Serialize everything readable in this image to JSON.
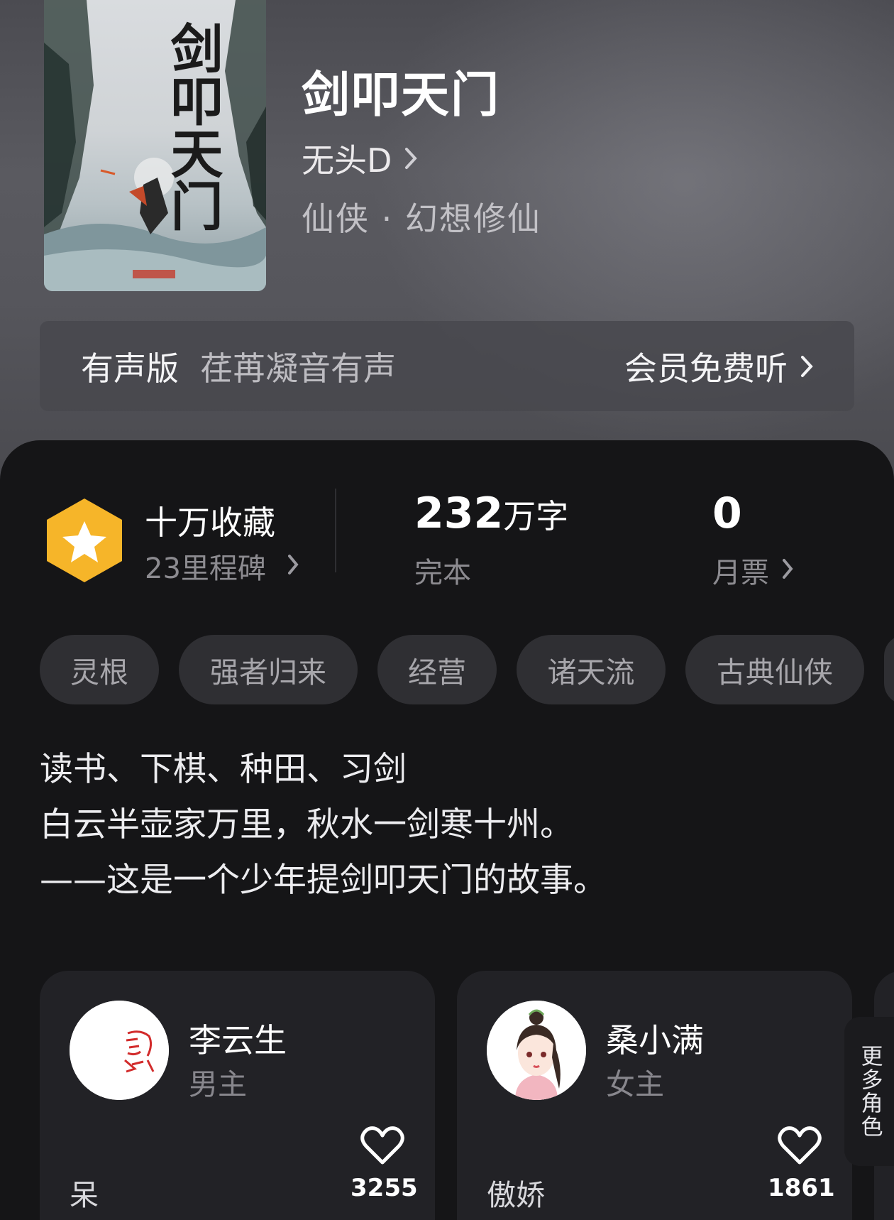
{
  "book": {
    "cover_title": "剑叩天门",
    "title": "剑叩天门",
    "author": "无头D",
    "genre": "仙侠 · 幻想修仙"
  },
  "audio": {
    "label": "有声版",
    "narrator": "荏苒凝音有声",
    "cta": "会员免费听"
  },
  "stats": {
    "collection": "十万收藏",
    "milestone": "23里程碑",
    "word_count": "232",
    "word_unit": "万字",
    "status": "完本",
    "monthly_votes": "0",
    "monthly_label": "月票"
  },
  "tags": [
    "灵根",
    "强者归来",
    "经营",
    "诸天流",
    "古典仙侠"
  ],
  "description": [
    "读书、下棋、种田、习剑",
    "白云半壶家万里，秋水一剑寒十州。",
    "——这是一个少年提剑叩天门的故事。"
  ],
  "characters": [
    {
      "name": "李云生",
      "role": "男主",
      "trait": "呆",
      "likes": "3255",
      "avatar_icon": "seal-stamp-icon"
    },
    {
      "name": "桑小满",
      "role": "女主",
      "trait": "傲娇",
      "likes": "1861",
      "avatar_icon": "girl-portrait-icon"
    }
  ],
  "more_roles": "更多角色",
  "colors": {
    "badge": "#f6b529",
    "background": "#151517",
    "card": "#222226",
    "tag": "#2f2f33"
  }
}
